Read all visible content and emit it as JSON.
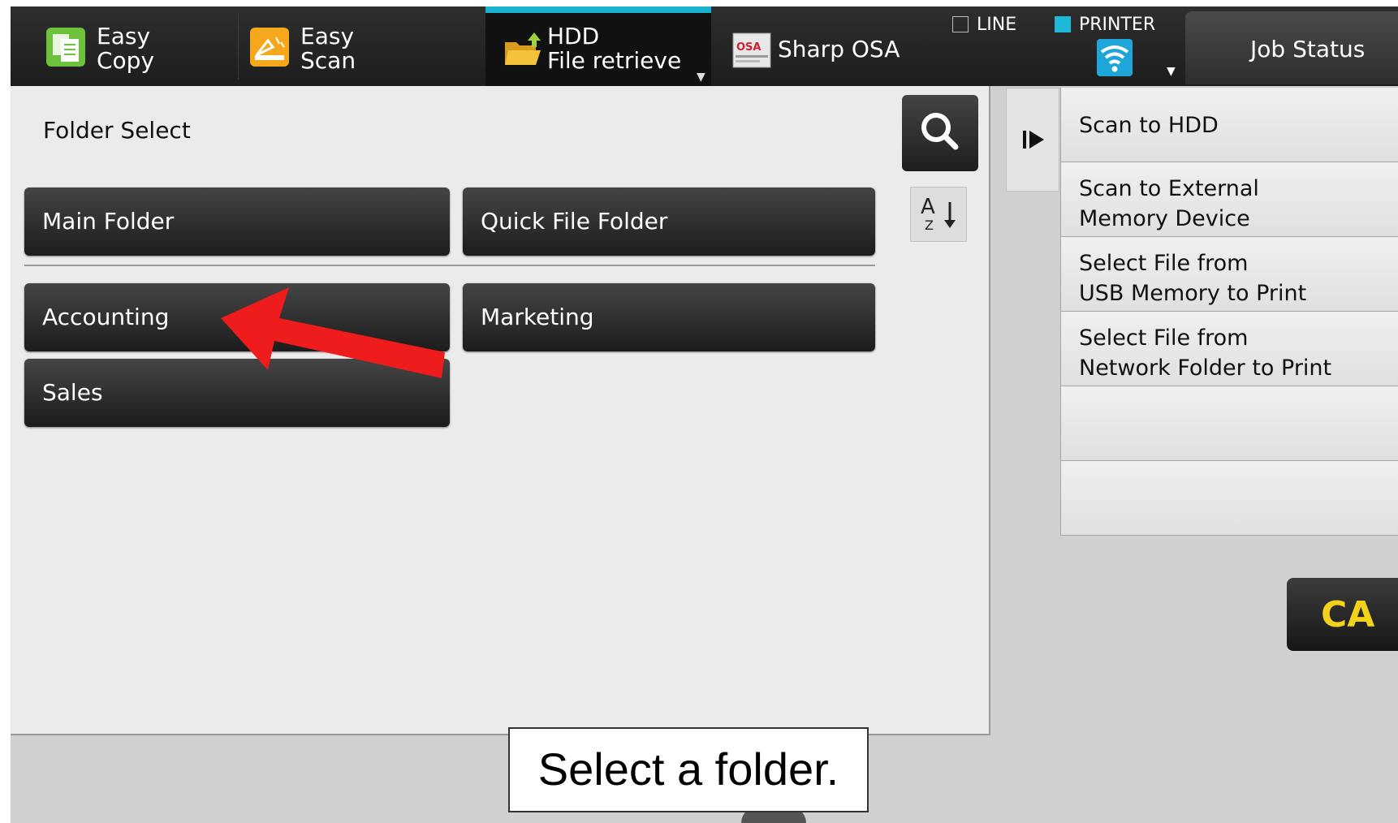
{
  "topbar": {
    "tabs": [
      {
        "line1": "Easy",
        "line2": "Copy",
        "icon": "copy-icon"
      },
      {
        "line1": "Easy",
        "line2": "Scan",
        "icon": "scan-icon"
      },
      {
        "line1": "HDD",
        "line2": "File retrieve",
        "icon": "folder-upload-icon",
        "active": true
      },
      {
        "line1": "Sharp OSA",
        "icon": "osa-logo-icon"
      }
    ],
    "osa_logo_text": "OSA",
    "line_label": "LINE",
    "printer_label": "PRINTER",
    "job_status_label": "Job Status",
    "colors": {
      "active_tab_accent": "#18b2cf",
      "printer_indicator": "#1fb8d6"
    }
  },
  "main": {
    "title": "Folder Select",
    "folders_top": [
      "Main Folder",
      "Quick File Folder"
    ],
    "folders": [
      "Accounting",
      "Marketing",
      "Sales"
    ],
    "search_icon": "search-icon",
    "sort_icon": "sort-az-icon",
    "sort_glyph_top": "A",
    "sort_glyph_bottom": "Z"
  },
  "side_menu": {
    "collapse_icon": "collapse-right-icon",
    "items": [
      {
        "line1": "Scan to HDD"
      },
      {
        "line1": "Scan to External",
        "line2": "Memory Device"
      },
      {
        "line1": "Select File from",
        "line2": "USB Memory to Print"
      },
      {
        "line1": "Select File from",
        "line2": "Network Folder to Print"
      },
      {
        "line1": ""
      },
      {
        "line1": ""
      }
    ],
    "ca_label": "CA",
    "colors": {
      "ca_text": "#f2d21a"
    }
  },
  "annotation": {
    "caption": "Select a folder.",
    "arrow_color": "#ee1c1c"
  }
}
